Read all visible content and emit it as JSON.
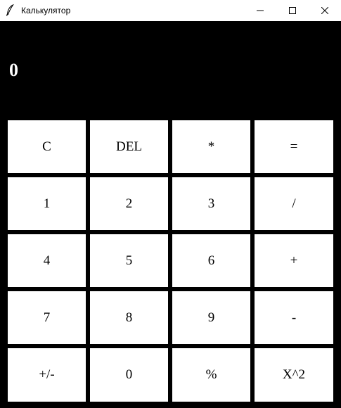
{
  "window": {
    "title": "Калькулятор",
    "icons": {
      "app": "feather-icon",
      "minimize": "minimize-icon",
      "maximize": "maximize-icon",
      "close": "close-icon"
    }
  },
  "display": {
    "value": "0"
  },
  "keypad": {
    "rows": [
      [
        "C",
        "DEL",
        "*",
        "="
      ],
      [
        "1",
        "2",
        "3",
        "/"
      ],
      [
        "4",
        "5",
        "6",
        "+"
      ],
      [
        "7",
        "8",
        "9",
        "-"
      ],
      [
        "+/-",
        "0",
        "%",
        "X^2"
      ]
    ]
  },
  "colors": {
    "background": "#000000",
    "key_face": "#ffffff",
    "display_text": "#ffffff"
  }
}
